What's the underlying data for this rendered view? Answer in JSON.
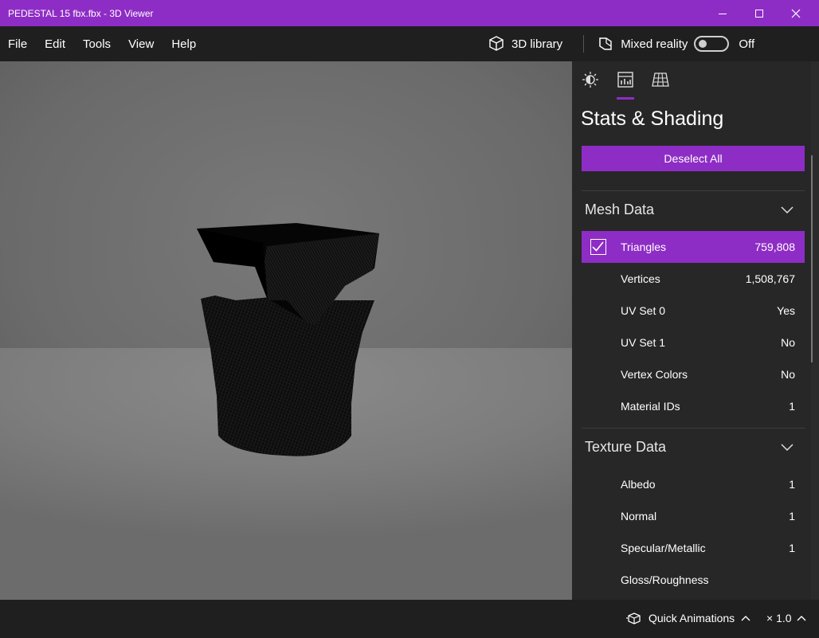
{
  "window": {
    "title": "PEDESTAL 15 fbx.fbx - 3D Viewer"
  },
  "menu": {
    "items": [
      "File",
      "Edit",
      "Tools",
      "View",
      "Help"
    ]
  },
  "toolbar": {
    "library_label": "3D library",
    "mixed_reality_label": "Mixed reality",
    "toggle_state": "Off"
  },
  "panel": {
    "title": "Stats & Shading",
    "deselect_label": "Deselect All",
    "mesh": {
      "title": "Mesh Data",
      "rows": [
        {
          "label": "Triangles",
          "value": "759,808",
          "checked": true
        },
        {
          "label": "Vertices",
          "value": "1,508,767"
        },
        {
          "label": "UV Set 0",
          "value": "Yes"
        },
        {
          "label": "UV Set 1",
          "value": "No"
        },
        {
          "label": "Vertex Colors",
          "value": "No"
        },
        {
          "label": "Material IDs",
          "value": "1"
        }
      ]
    },
    "texture": {
      "title": "Texture Data",
      "rows": [
        {
          "label": "Albedo",
          "value": "1"
        },
        {
          "label": "Normal",
          "value": "1"
        },
        {
          "label": "Specular/Metallic",
          "value": "1"
        },
        {
          "label": "Gloss/Roughness",
          "value": ""
        }
      ]
    }
  },
  "bottom": {
    "quick_animations_label": "Quick Animations",
    "speed_label": "× 1.0"
  },
  "icons": {
    "app_accent": "#8e2dc5",
    "tab_icons": [
      "lighting-icon",
      "stats-icon",
      "grid-icon"
    ]
  }
}
